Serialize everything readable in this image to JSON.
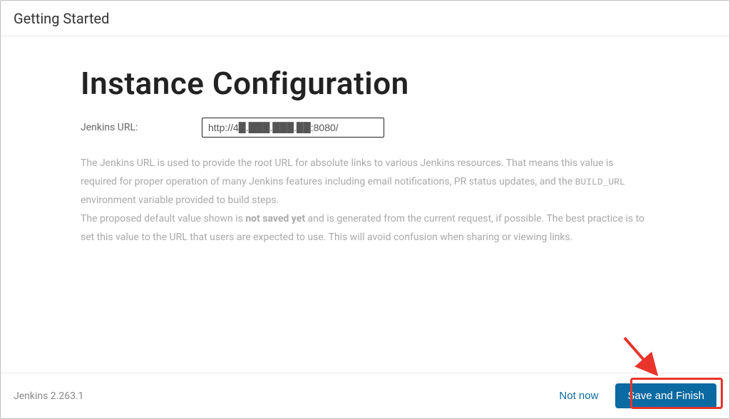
{
  "header": {
    "title": "Getting Started"
  },
  "main": {
    "title": "Instance Configuration",
    "field": {
      "label": "Jenkins URL:",
      "value": "http://4█.███.███.██:8080/"
    },
    "desc": {
      "p1_a": "The Jenkins URL is used to provide the root URL for absolute links to various Jenkins resources. That means this value is required for proper operation of many Jenkins features including email notifications, PR status updates, and the ",
      "p1_code": "BUILD_URL",
      "p1_b": " environment variable provided to build steps.",
      "p2_a": "The proposed default value shown is ",
      "p2_bold": "not saved yet",
      "p2_b": " and is generated from the current request, if possible. The best practice is to set this value to the URL that users are expected to use. This will avoid confusion when sharing or viewing links."
    }
  },
  "footer": {
    "version": "Jenkins 2.263.1",
    "not_now": "Not now",
    "save": "Save and Finish"
  },
  "annotation": {
    "highlight_color": "#e8342a"
  }
}
